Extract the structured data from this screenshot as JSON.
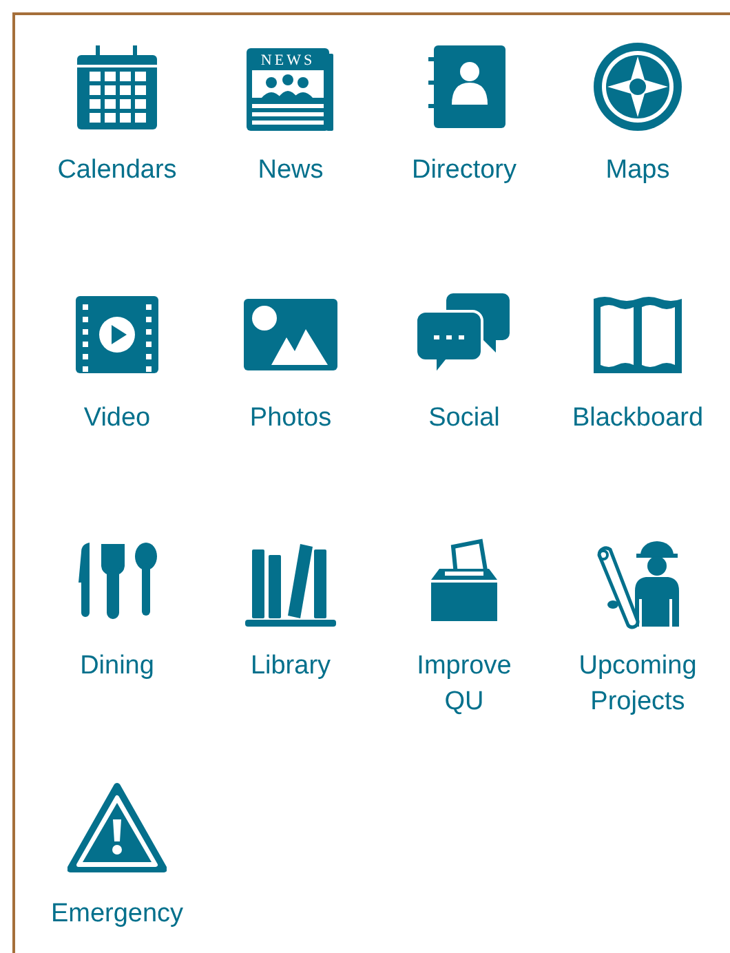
{
  "tiles": [
    {
      "kind": "calendar",
      "label": "Calendars"
    },
    {
      "kind": "news",
      "label": "News",
      "icon_text": "NEWS"
    },
    {
      "kind": "directory",
      "label": "Directory"
    },
    {
      "kind": "compass",
      "label": "Maps"
    },
    {
      "kind": "video",
      "label": "Video"
    },
    {
      "kind": "photo",
      "label": "Photos"
    },
    {
      "kind": "chat",
      "label": "Social"
    },
    {
      "kind": "book",
      "label": "Blackboard"
    },
    {
      "kind": "dining",
      "label": "Dining"
    },
    {
      "kind": "library",
      "label": "Library"
    },
    {
      "kind": "ballot",
      "label": "Improve QU"
    },
    {
      "kind": "worker",
      "label": "Upcoming Projects"
    },
    {
      "kind": "warning",
      "label": "Emergency"
    }
  ]
}
